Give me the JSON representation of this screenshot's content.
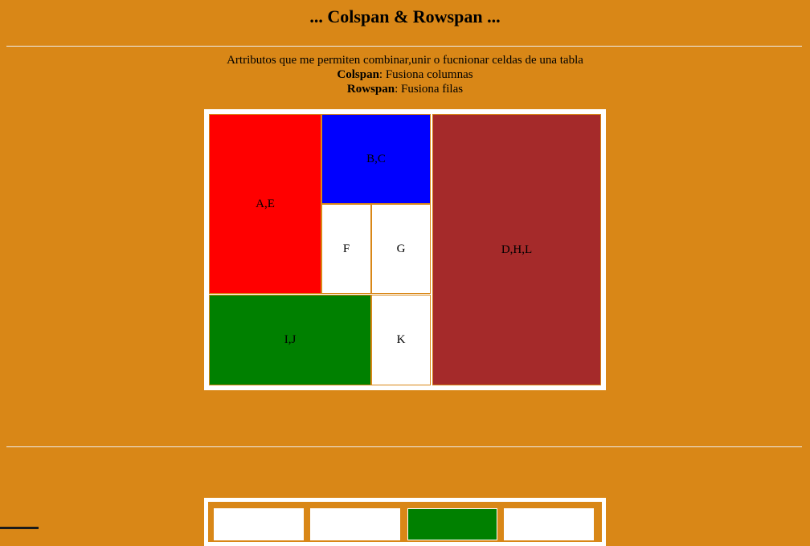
{
  "header": {
    "title": "... Colspan & Rowspan ..."
  },
  "intro": {
    "line1": "Artributos que me permiten combinar,unir o fucnionar celdas de una tabla",
    "colspan_term": "Colspan",
    "colspan_desc": ": Fusiona columnas",
    "rowspan_term": "Rowspan",
    "rowspan_desc": ": Fusiona filas"
  },
  "table1": {
    "cells": [
      {
        "label": "A,E",
        "color": "#ff0000"
      },
      {
        "label": "B,C",
        "color": "#0000ff"
      },
      {
        "label": "D,H,L",
        "color": "#a52a2a"
      },
      {
        "label": "F",
        "color": "#ffffff"
      },
      {
        "label": "G",
        "color": "#ffffff"
      },
      {
        "label": "I,J",
        "color": "#008000"
      },
      {
        "label": "K",
        "color": "#ffffff"
      }
    ]
  },
  "table2": {
    "cell_colors": [
      "#ffffff",
      "#ffffff",
      "#008000",
      "#ffffff"
    ]
  },
  "colors": {
    "background": "#d98717",
    "rule": "#eeeeee"
  }
}
